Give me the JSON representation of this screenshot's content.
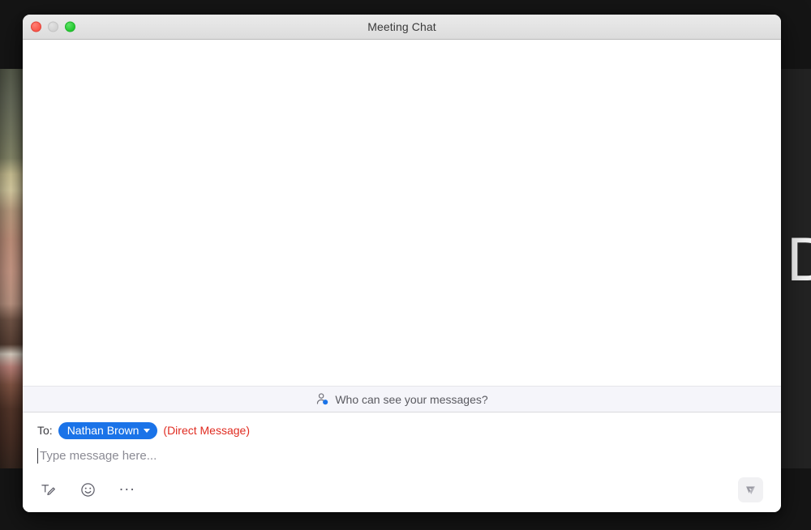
{
  "window": {
    "title": "Meeting Chat",
    "controls": {
      "close": "close-button",
      "minimize": "minimize-button",
      "zoom": "zoom-button"
    }
  },
  "background": {
    "participant_avatar_initial": "D"
  },
  "message_list": {
    "messages": []
  },
  "privacy_notice": {
    "label": "Who can see your messages?",
    "icon": "person-privacy-icon"
  },
  "composer": {
    "to_label": "To:",
    "recipient": "Nathan Brown",
    "recipient_dropdown_icon": "chevron-down-icon",
    "message_type_tag": "(Direct Message)",
    "message_value": "",
    "message_placeholder": "Type message here...",
    "toolbar": {
      "format_label": "Format",
      "emoji_label": "Emoji",
      "more_label": "...",
      "send_label": "Send"
    }
  },
  "colors": {
    "accent_blue": "#1a73e8",
    "direct_message_red": "#e02b20",
    "privacy_bar_bg": "#f5f5fa",
    "titlebar_bg": "#dcdcdc",
    "send_button_bg": "#f1f1f3"
  }
}
